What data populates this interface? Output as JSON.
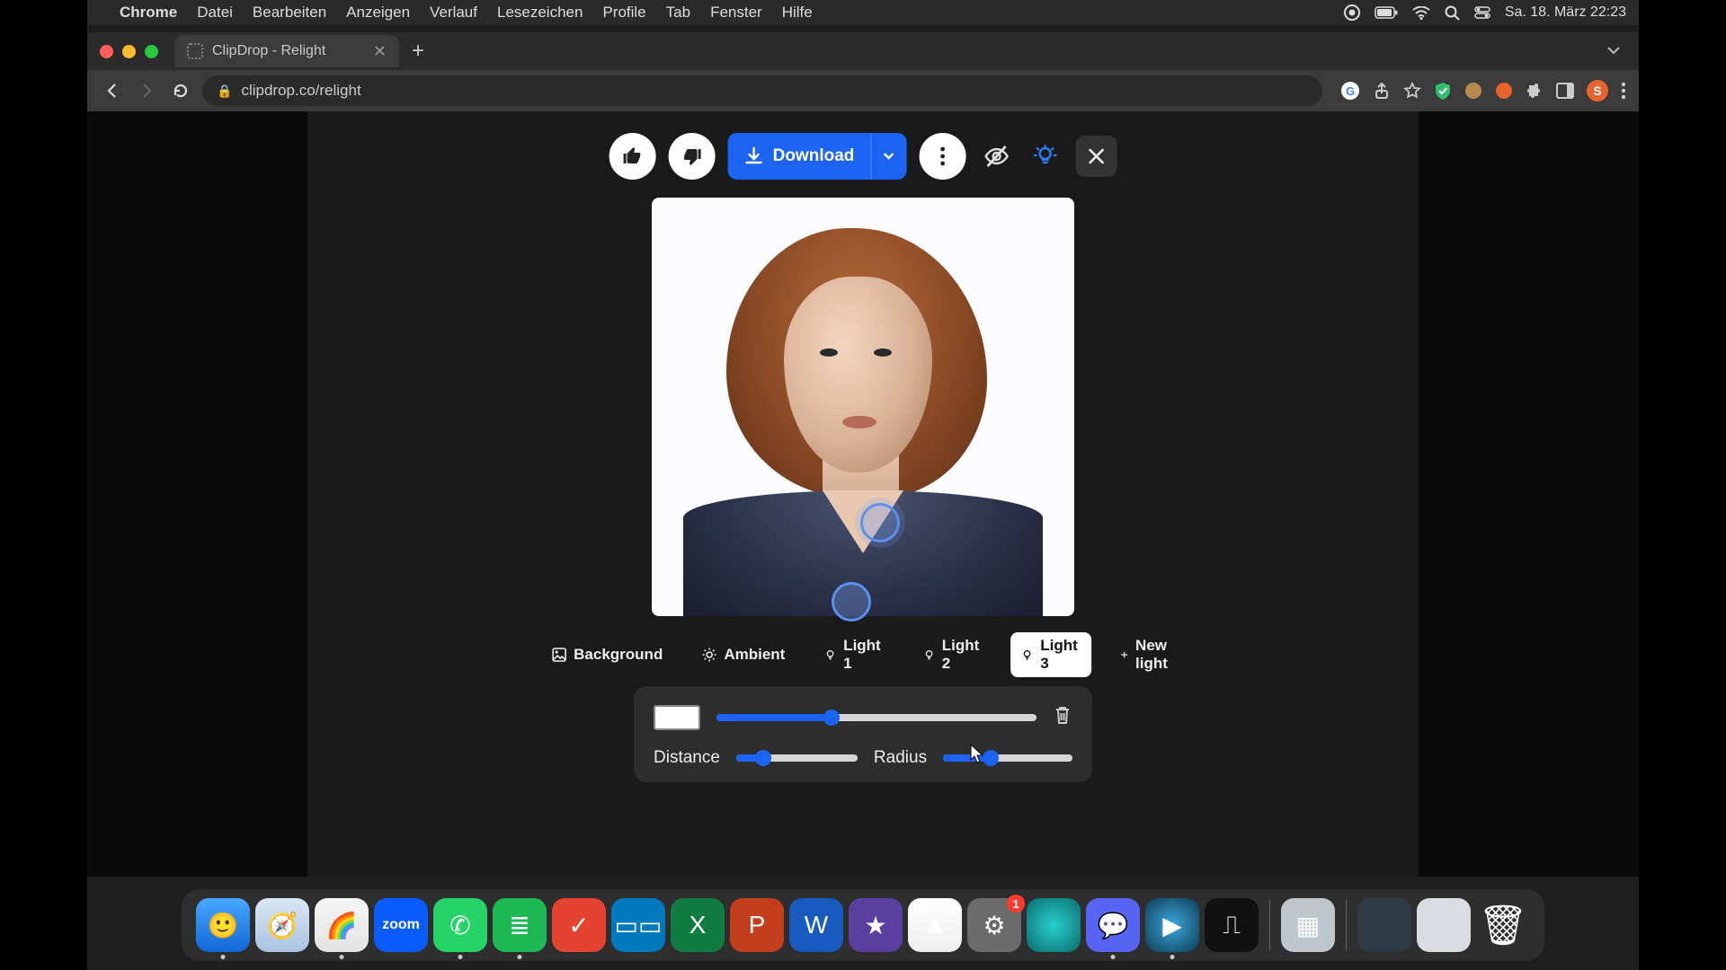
{
  "menubar": {
    "apple": "",
    "app": "Chrome",
    "items": [
      "Datei",
      "Bearbeiten",
      "Anzeigen",
      "Verlauf",
      "Lesezeichen",
      "Profile",
      "Tab",
      "Fenster",
      "Hilfe"
    ],
    "clock": "Sa. 18. März  22:23"
  },
  "tab": {
    "title": "ClipDrop - Relight"
  },
  "address": {
    "url": "clipdrop.co/relight"
  },
  "avatar_letter": "S",
  "toolbar": {
    "download": "Download"
  },
  "light_tabs": {
    "background": "Background",
    "ambient": "Ambient",
    "light1": "Light 1",
    "light2": "Light 2",
    "light3": "Light 3",
    "newlight": "New light",
    "active": "light3"
  },
  "sliders": {
    "intensity_pct": 36,
    "distance_label": "Distance",
    "distance_pct": 22,
    "radius_label": "Radius",
    "radius_pct": 37
  },
  "light_color": "#ffffff",
  "dock": {
    "apps": [
      {
        "name": "Finder",
        "bg": "linear-gradient(#4aa8ff,#1067d6)",
        "glyph": "🙂",
        "running": true
      },
      {
        "name": "Safari",
        "bg": "linear-gradient(#d9e7f5,#a9c3e0)",
        "glyph": "🧭",
        "running": false
      },
      {
        "name": "Chrome",
        "bg": "linear-gradient(#f6f6f6,#e2e2e2)",
        "glyph": "🌈",
        "running": true
      },
      {
        "name": "Zoom",
        "bg": "#0b5cff",
        "glyph": "zoom",
        "text": true,
        "running": false
      },
      {
        "name": "WhatsApp",
        "bg": "#25d366",
        "glyph": "✆",
        "running": true
      },
      {
        "name": "Spotify",
        "bg": "#1db954",
        "glyph": "≣",
        "running": true
      },
      {
        "name": "Todoist",
        "bg": "#e44332",
        "glyph": "✓",
        "running": false
      },
      {
        "name": "Trello",
        "bg": "#0079bf",
        "glyph": "▭▭",
        "running": false
      },
      {
        "name": "Excel",
        "bg": "#107c41",
        "glyph": "X",
        "running": false
      },
      {
        "name": "PowerPoint",
        "bg": "#c43e1c",
        "glyph": "P",
        "running": false
      },
      {
        "name": "Word",
        "bg": "#185abd",
        "glyph": "W",
        "running": false
      },
      {
        "name": "iMovie",
        "bg": "#5b3fa0",
        "glyph": "★",
        "running": false
      },
      {
        "name": "Drive",
        "bg": "linear-gradient(#ffffff,#eeeeee)",
        "glyph": "▲",
        "running": false
      },
      {
        "name": "Settings",
        "bg": "#6b6b6b",
        "glyph": "⚙",
        "badge": "1",
        "running": false
      },
      {
        "name": "Siri",
        "bg": "radial-gradient(circle,#29d0d0,#0b6a6a)",
        "glyph": "",
        "running": false
      },
      {
        "name": "Discord",
        "bg": "#5865f2",
        "glyph": "💬",
        "running": true
      },
      {
        "name": "QuickTime",
        "bg": "radial-gradient(circle,#3ba9e0,#0d3a52)",
        "glyph": "▶",
        "running": true
      },
      {
        "name": "VoiceMemos",
        "bg": "#111",
        "glyph": "⎍",
        "running": false
      }
    ],
    "right": [
      {
        "name": "LaunchPad",
        "bg": "#bfc6cc",
        "glyph": "▦"
      },
      {
        "name": "Desktop1",
        "bg": "#2e3a44",
        "glyph": ""
      },
      {
        "name": "Desktop2",
        "bg": "#d9dde1",
        "glyph": ""
      },
      {
        "name": "Trash",
        "bg": "transparent",
        "glyph": "🗑"
      }
    ]
  }
}
